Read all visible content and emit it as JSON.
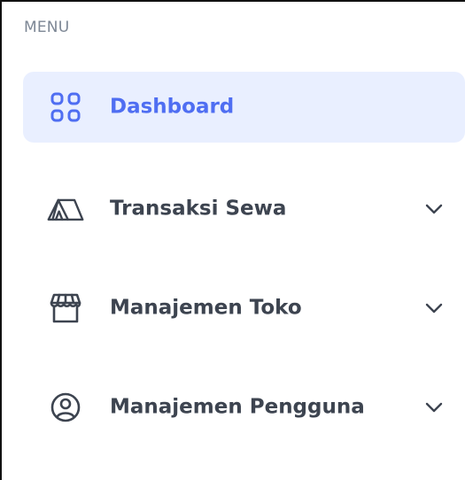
{
  "sidebar": {
    "heading": "MENU",
    "items": [
      {
        "label": "Dashboard",
        "icon": "grid-icon",
        "active": true,
        "has_submenu": false
      },
      {
        "label": "Transaksi Sewa",
        "icon": "tent-icon",
        "active": false,
        "has_submenu": true
      },
      {
        "label": "Manajemen Toko",
        "icon": "store-icon",
        "active": false,
        "has_submenu": true
      },
      {
        "label": "Manajemen Pengguna",
        "icon": "user-circle-icon",
        "active": false,
        "has_submenu": true
      }
    ]
  },
  "colors": {
    "accent": "#4f6ef2",
    "active_background": "#e9efff",
    "text": "#3d4450",
    "muted": "#7d8795"
  }
}
